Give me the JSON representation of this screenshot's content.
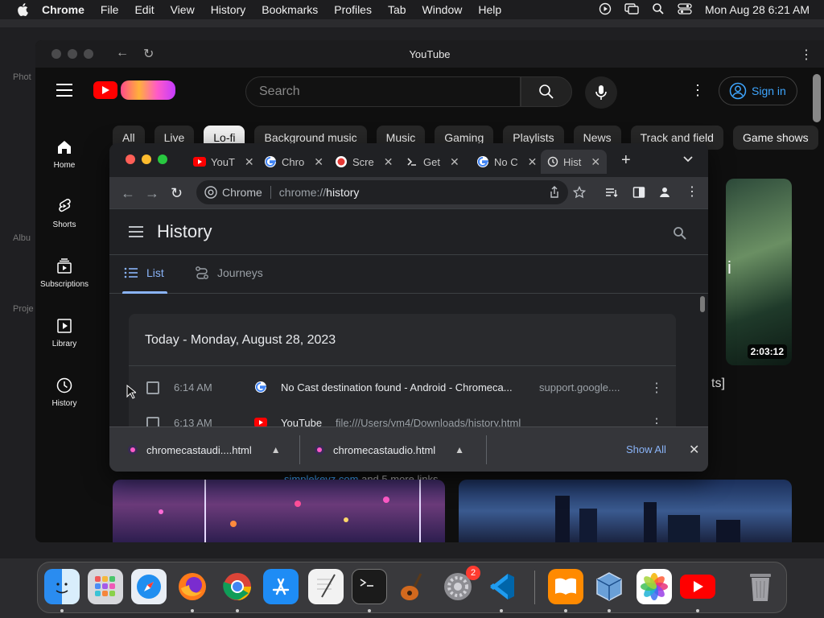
{
  "menubar": {
    "app": "Chrome",
    "items": [
      "File",
      "Edit",
      "View",
      "History",
      "Bookmarks",
      "Profiles",
      "Tab",
      "Window",
      "Help"
    ],
    "clock": "Mon Aug 28  6:21 AM"
  },
  "background_window": {
    "sidebar_hints": [
      "Phot",
      "Albu",
      "Proje"
    ]
  },
  "youtube": {
    "window_title": "YouTube",
    "search_placeholder": "Search",
    "sign_in": "Sign in",
    "sidebar": [
      {
        "label": "Home",
        "icon": "home-icon"
      },
      {
        "label": "Shorts",
        "icon": "shorts-icon"
      },
      {
        "label": "Subscriptions",
        "icon": "subscriptions-icon"
      },
      {
        "label": "Library",
        "icon": "library-icon"
      },
      {
        "label": "History",
        "icon": "history-icon"
      }
    ],
    "chips": [
      "All",
      "Live",
      "Lo-fi",
      "Background music",
      "Music",
      "Gaming",
      "Playlists",
      "News",
      "Track and field",
      "Game shows"
    ],
    "active_chip": "Lo-fi",
    "video_duration": "2:03:12",
    "partial_title": "ts]",
    "partial_char": "i",
    "links_domain": "simplekeyz.com",
    "links_suffix": "and 5 more links",
    "accent": "#ff0000",
    "link_color": "#3ea6ff"
  },
  "chrome": {
    "tabs": [
      {
        "label": "YouT",
        "icon": "youtube-favicon"
      },
      {
        "label": "Chro",
        "icon": "google-favicon"
      },
      {
        "label": "Scre",
        "icon": "record-favicon"
      },
      {
        "label": "Get",
        "icon": "github-favicon"
      },
      {
        "label": "No C",
        "icon": "google-favicon"
      },
      {
        "label": "Hist",
        "icon": "history-icon",
        "active": true
      }
    ],
    "omnibox": {
      "site": "Chrome",
      "url_scheme": "chrome://",
      "url_path": "history"
    },
    "history": {
      "title": "History",
      "tabs": [
        {
          "label": "List",
          "active": true
        },
        {
          "label": "Journeys",
          "active": false
        }
      ],
      "date_heading": "Today - Monday, August 28, 2023",
      "rows": [
        {
          "time": "6:14 AM",
          "title": "No Cast destination found - Android - Chromeca...",
          "domain": "support.google....",
          "favicon": "google-favicon"
        },
        {
          "time": "6:13 AM",
          "title": "YouTube",
          "domain": "file:///Users/vm4/Downloads/history.html",
          "favicon": "youtube-favicon"
        }
      ]
    },
    "downloads": {
      "items": [
        "chromecastaudi....html",
        "chromecastaudio.html"
      ],
      "show_all": "Show All"
    },
    "link_accent": "#8ab4f8"
  },
  "dock": {
    "apps": [
      "Finder",
      "Launchpad",
      "Safari",
      "Firefox",
      "Chrome",
      "App Store",
      "TextEdit",
      "Terminal",
      "GarageBand",
      "System Settings",
      "Visual Studio Code",
      "Books",
      "VirtualBox",
      "Photos",
      "YouTube",
      "Trash"
    ],
    "system_settings_badge": "2"
  }
}
